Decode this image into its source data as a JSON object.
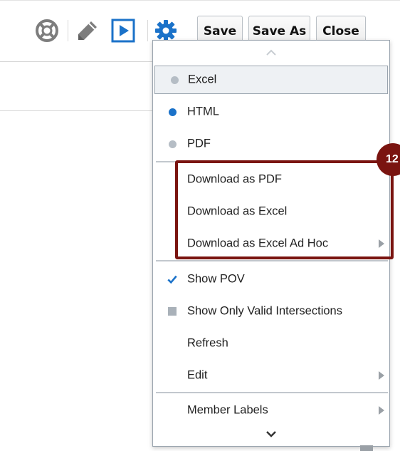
{
  "toolbar": {
    "icons": [
      "help-lifebuoy-icon",
      "edit-pencil-icon",
      "run-play-icon",
      "settings-gear-icon"
    ],
    "save_label": "Save",
    "save_as_label": "Save As",
    "close_label": "Close"
  },
  "menu": {
    "items": [
      {
        "label": "Excel",
        "state": "highlighted"
      },
      {
        "label": "HTML",
        "state": "selected-format"
      },
      {
        "label": "PDF"
      },
      {
        "label": "Download as PDF"
      },
      {
        "label": "Download as Excel"
      },
      {
        "label": "Download as Excel Ad Hoc",
        "has_submenu": true
      },
      {
        "label": "Show POV",
        "checked": true
      },
      {
        "label": "Show Only Valid Intersections"
      },
      {
        "label": "Refresh"
      },
      {
        "label": "Edit",
        "has_submenu": true
      },
      {
        "label": "Member Labels",
        "has_submenu": true
      }
    ]
  },
  "callout": {
    "number": "12",
    "color": "#7a1410"
  },
  "colors": {
    "accent": "#1b72c9",
    "callout": "#7a1410",
    "menu_border": "#9aa4ae"
  }
}
